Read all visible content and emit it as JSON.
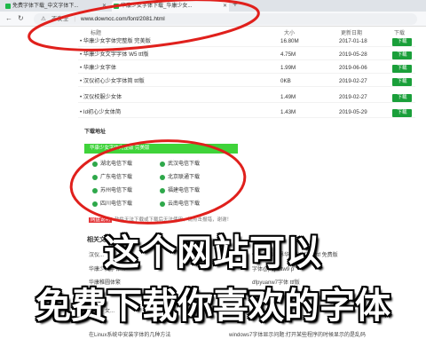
{
  "browser": {
    "tabs": [
      {
        "title": "免费字体下载_中文字体下..."
      },
      {
        "title": "华康少女字体下载_华康少女..."
      }
    ],
    "new_tab": "+",
    "security": "不安全",
    "url": "www.downcc.com/font/2081.html",
    "back_icon": "back-arrow-icon",
    "refresh_icon": "refresh-icon"
  },
  "table": {
    "headers": {
      "title": "标题",
      "size": "大小",
      "date": "更新日期",
      "action": "下载"
    },
    "rows": [
      {
        "name": "华康少女字体完整版 完美版",
        "size": "16.80M",
        "date": "2017-01-18",
        "button": "下载"
      },
      {
        "name": "华康少女文字字体 W5 ttf版",
        "size": "4.75M",
        "date": "2019-05-28",
        "button": "下载"
      },
      {
        "name": "华康少女字体",
        "size": "1.99M",
        "date": "2019-06-06",
        "button": "下载"
      },
      {
        "name": "汉仪初心少女字体简 ttf版",
        "size": "0KB",
        "date": "2019-02-27",
        "button": "下载"
      },
      {
        "name": "汉仪校服少女体",
        "size": "1.49M",
        "date": "2019-02-27",
        "button": "下载"
      },
      {
        "name": "Id初心少女体简",
        "size": "1.43M",
        "date": "2019-05-29",
        "button": "下载"
      }
    ]
  },
  "download": {
    "section_title": "下载地址",
    "bar_label": "华康少女字体完整版 完美版",
    "links": [
      {
        "label": "湖北电信下载"
      },
      {
        "label": "武汉电信下载"
      },
      {
        "label": "广东电信下载"
      },
      {
        "label": "北京联通下载"
      },
      {
        "label": "苏州电信下载"
      },
      {
        "label": "福建电信下载"
      },
      {
        "label": "四川电信下载"
      },
      {
        "label": "云南电信下载"
      }
    ],
    "notice_badge": "网盘说明",
    "notice_text": "软件无法下载或下载后无法使用，请点击报错，谢谢！"
  },
  "related": {
    "title": "相关文章",
    "items": [
      {
        "text": "汉仪..."
      },
      {
        "text": "wow魔兽世界华康少女字体ttf 免费版"
      },
      {
        "text": "华康少女字体..."
      },
      {
        "text": "字体@pop2ltw9 p"
      },
      {
        "text": "华康稚圆体繁"
      },
      {
        "text": "dfpyuanw7字体 ttf版"
      },
      {
        "text": "华康少女..."
      },
      {
        "text": "华康少女..."
      },
      {
        "text": "在Linux系统中安装字体的几种方法"
      },
      {
        "text": "windows7字体显示问题:打开某些程序的时候显示的是乱码"
      }
    ]
  },
  "overlay": {
    "line1": "这个网站可以",
    "line2": "免费下载你喜欢的字体"
  },
  "colors": {
    "accent_green": "#1a9f3a",
    "bar_green": "#3fd33a",
    "annotation_red": "#e0201c"
  }
}
